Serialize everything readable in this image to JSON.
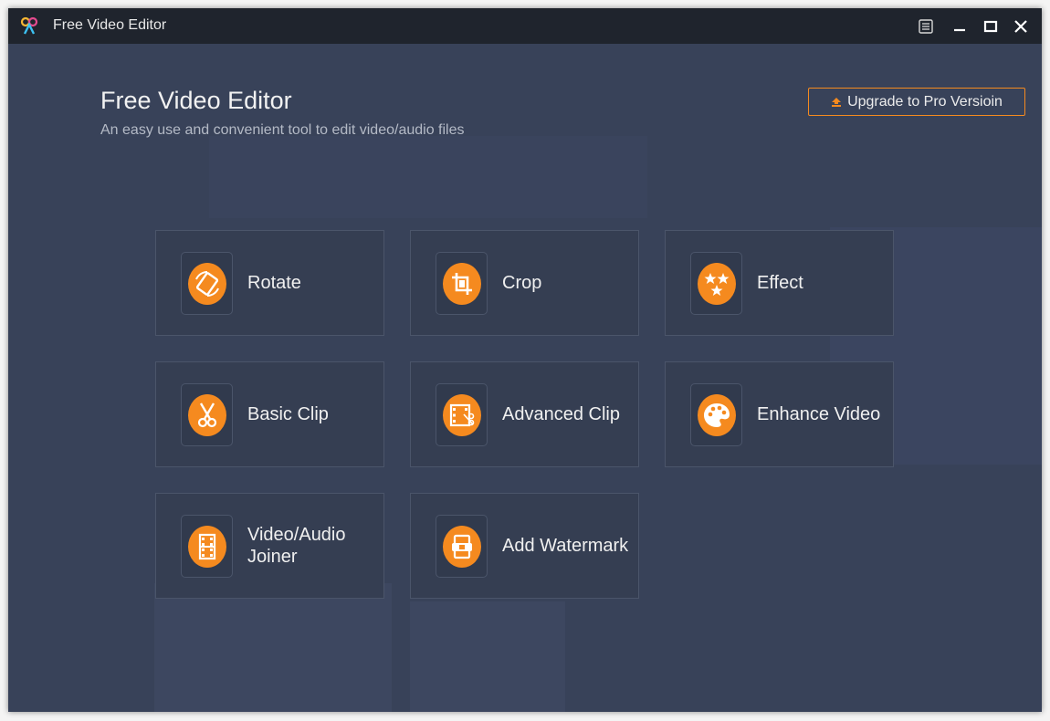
{
  "window": {
    "title": "Free Video Editor"
  },
  "header": {
    "title": "Free Video Editor",
    "subtitle": "An easy use and convenient tool to edit video/audio files",
    "upgrade_label": "Upgrade to Pro Versioin"
  },
  "colors": {
    "accent": "#f58a1f",
    "background": "#384259",
    "titlebar": "#1f242d",
    "tile": "#353e52"
  },
  "tools": [
    {
      "label": "Rotate",
      "icon": "rotate-icon"
    },
    {
      "label": "Crop",
      "icon": "crop-icon"
    },
    {
      "label": "Effect",
      "icon": "effect-icon"
    },
    {
      "label": "Basic Clip",
      "icon": "scissors-icon"
    },
    {
      "label": "Advanced Clip",
      "icon": "advanced-clip-icon"
    },
    {
      "label": "Enhance Video",
      "icon": "palette-icon"
    },
    {
      "label": "Video/Audio Joiner",
      "icon": "film-joiner-icon"
    },
    {
      "label": "Add Watermark",
      "icon": "watermark-icon"
    }
  ]
}
